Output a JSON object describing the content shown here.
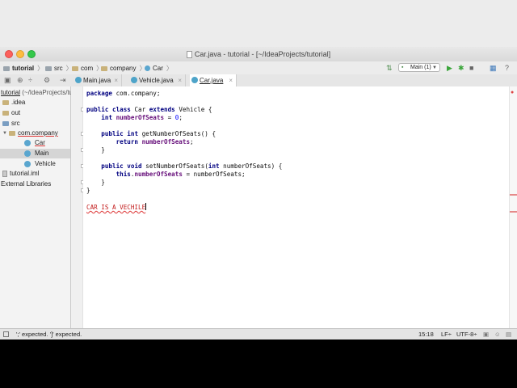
{
  "window": {
    "title": "Car.java - tutorial - [~/IdeaProjects/tutorial]"
  },
  "breadcrumb": [
    "tutorial",
    "src",
    "com",
    "company",
    "Car"
  ],
  "run_config": {
    "label": "Main (1)"
  },
  "tabs": [
    {
      "label": "Main.java",
      "close": "×"
    },
    {
      "label": "Vehicle.java",
      "close": "×"
    },
    {
      "label": "Car.java",
      "close": "×"
    }
  ],
  "project_tree": {
    "root": "tutorial",
    "root_path": "(~/IdeaProjects/tutorial)",
    "items": [
      "idea",
      "out",
      "src",
      "com.company",
      "Car",
      "Main",
      "Vehicle",
      "tutorial.iml",
      "External Libraries"
    ]
  },
  "code": {
    "package_kw": "package",
    "package_name": " com.company;",
    "class_kw": "public class",
    "class_name": " Car ",
    "extends_kw": "extends",
    "parent": " Vehicle {",
    "int_kw": "int",
    "field": "numberOfSeats",
    "eq": " = ",
    "zero": "0",
    "semi": ";",
    "getter_kw": "public int",
    "getter_name": " getNumberOfSeats() {",
    "return_kw": "return",
    "return_field": "numberOfSeats",
    "close_brace": "}",
    "setter_kw": "public void",
    "setter_name": " setNumberOfSeats(",
    "param_kw": "int",
    "param": " numberOfSeats) {",
    "this_kw": "this",
    "this_field": "numberOfSeats",
    "assign": " = numberOfSeats;",
    "class_close": "}",
    "error_line": "CAR IS A VECHILE"
  },
  "status": {
    "message": "';' expected. ']' expected.",
    "position": "15:18",
    "line_sep": "LF÷",
    "encoding": "UTF-8÷"
  }
}
